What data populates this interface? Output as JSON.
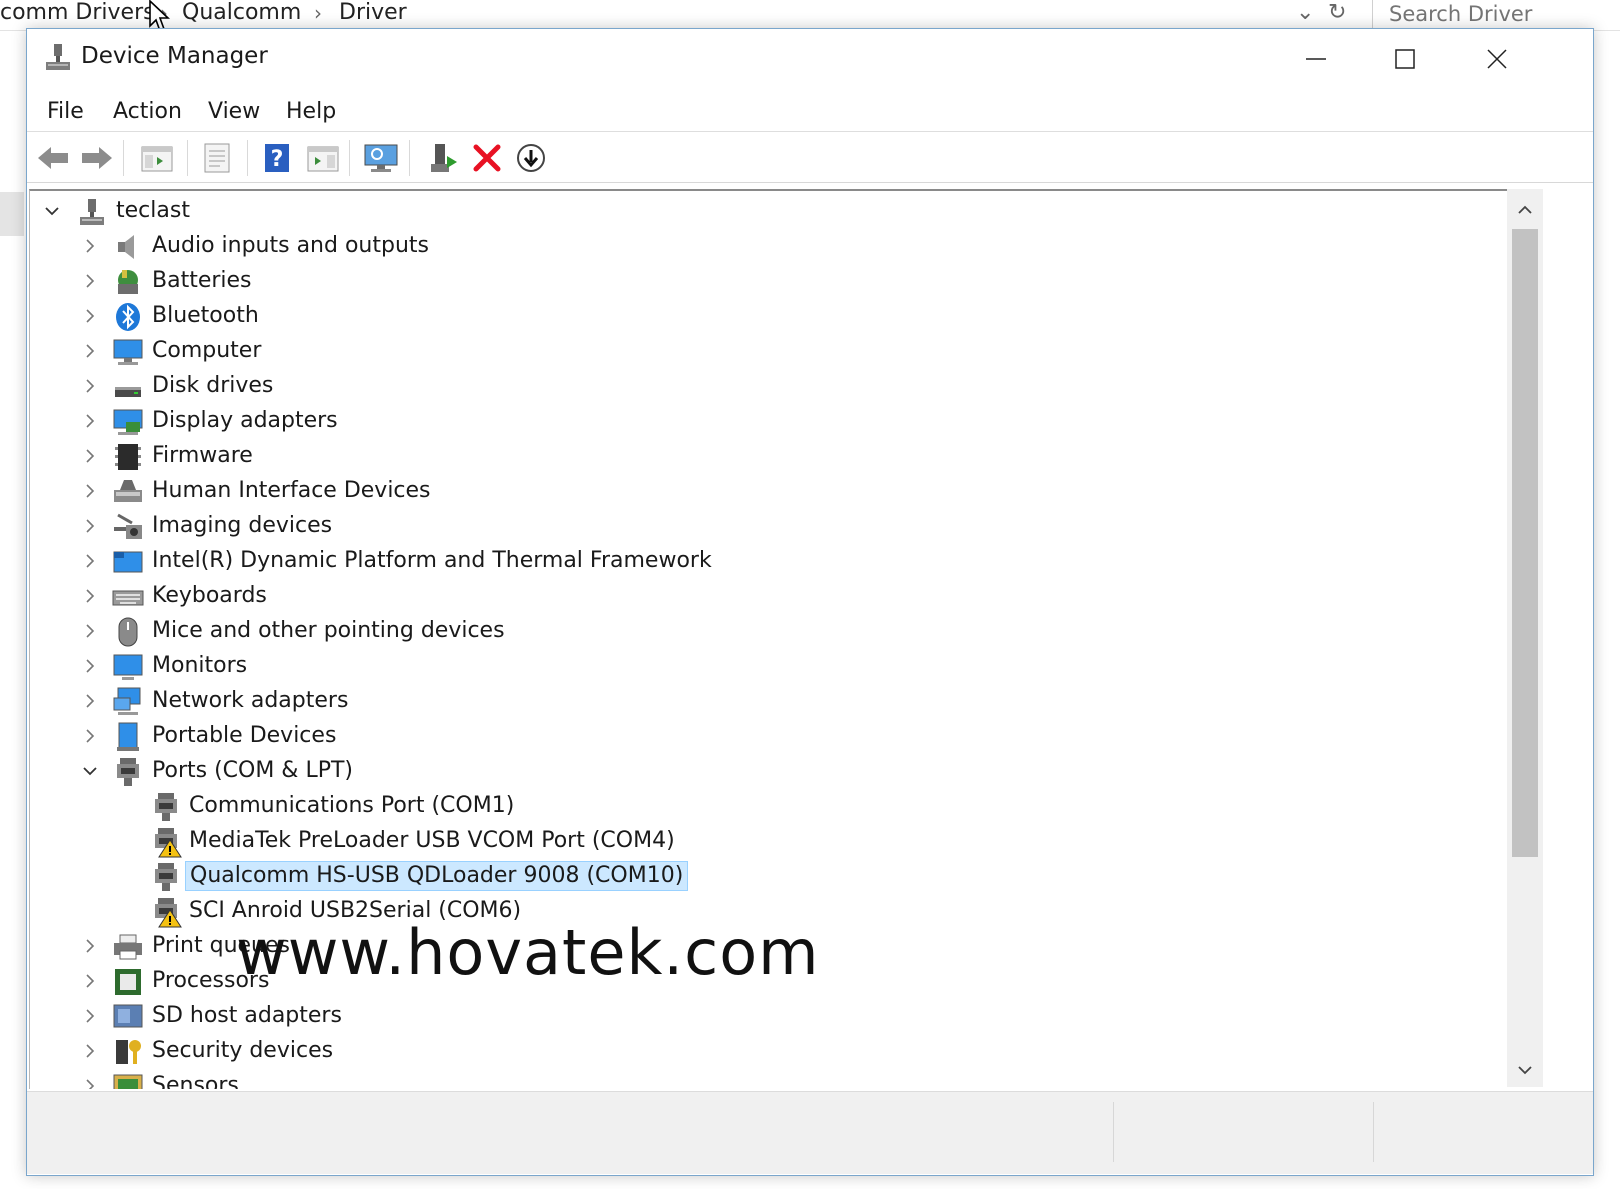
{
  "explorer": {
    "breadcrumbs": [
      "comm Drivers",
      "Qualcomm",
      "Driver"
    ],
    "search_placeholder": "Search Driver"
  },
  "window": {
    "title": "Device Manager",
    "menu": [
      "File",
      "Action",
      "View",
      "Help"
    ]
  },
  "tree": {
    "root": "teclast",
    "categories": [
      "Audio inputs and outputs",
      "Batteries",
      "Bluetooth",
      "Computer",
      "Disk drives",
      "Display adapters",
      "Firmware",
      "Human Interface Devices",
      "Imaging devices",
      "Intel(R) Dynamic Platform and Thermal Framework",
      "Keyboards",
      "Mice and other pointing devices",
      "Monitors",
      "Network adapters",
      "Portable Devices",
      "Ports (COM & LPT)"
    ],
    "ports": [
      {
        "label": "Communications Port (COM1)",
        "warning": false
      },
      {
        "label": "MediaTek PreLoader USB VCOM Port (COM4)",
        "warning": true
      },
      {
        "label": "Qualcomm HS-USB QDLoader 9008 (COM10)",
        "warning": false,
        "selected": true
      },
      {
        "label": "SCI Anroid USB2Serial (COM6)",
        "warning": true
      }
    ],
    "after": [
      "Print queues",
      "Processors",
      "SD host adapters",
      "Security devices",
      "Sensors"
    ]
  },
  "watermark": "www.hovatek.com",
  "colors": {
    "selection_bg": "#cce8ff",
    "selection_border": "#99d1ff",
    "delete_red": "#e81123",
    "window_border": "#7aa6cc"
  }
}
